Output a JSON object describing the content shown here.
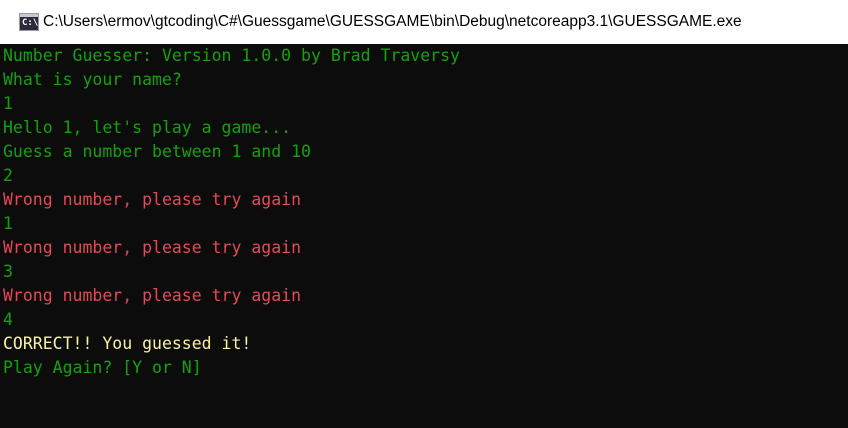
{
  "window": {
    "title": "C:\\Users\\ermov\\gtcoding\\C#\\Guessgame\\GUESSGAME\\bin\\Debug\\netcoreapp3.1\\GUESSGAME.exe",
    "icon_glyph": "C:\\",
    "icon": "console-app-icon"
  },
  "colors": {
    "green": "#13a10e",
    "red": "#e74856",
    "yellow": "#f9f1a5",
    "background": "#0c0c0c"
  },
  "console": {
    "lines": [
      {
        "text": "Number Guesser: Version 1.0.0 by Brad Traversy",
        "color": "green"
      },
      {
        "text": "What is your name?",
        "color": "green"
      },
      {
        "text": "1",
        "color": "green"
      },
      {
        "text": "Hello 1, let's play a game...",
        "color": "green"
      },
      {
        "text": "Guess a number between 1 and 10",
        "color": "green"
      },
      {
        "text": "2",
        "color": "green"
      },
      {
        "text": "Wrong number, please try again",
        "color": "red"
      },
      {
        "text": "1",
        "color": "green"
      },
      {
        "text": "Wrong number, please try again",
        "color": "red"
      },
      {
        "text": "3",
        "color": "green"
      },
      {
        "text": "Wrong number, please try again",
        "color": "red"
      },
      {
        "text": "4",
        "color": "green"
      },
      {
        "text": "CORRECT!! You guessed it!",
        "color": "yellow"
      },
      {
        "text": "Play Again? [Y or N]",
        "color": "green"
      }
    ]
  }
}
